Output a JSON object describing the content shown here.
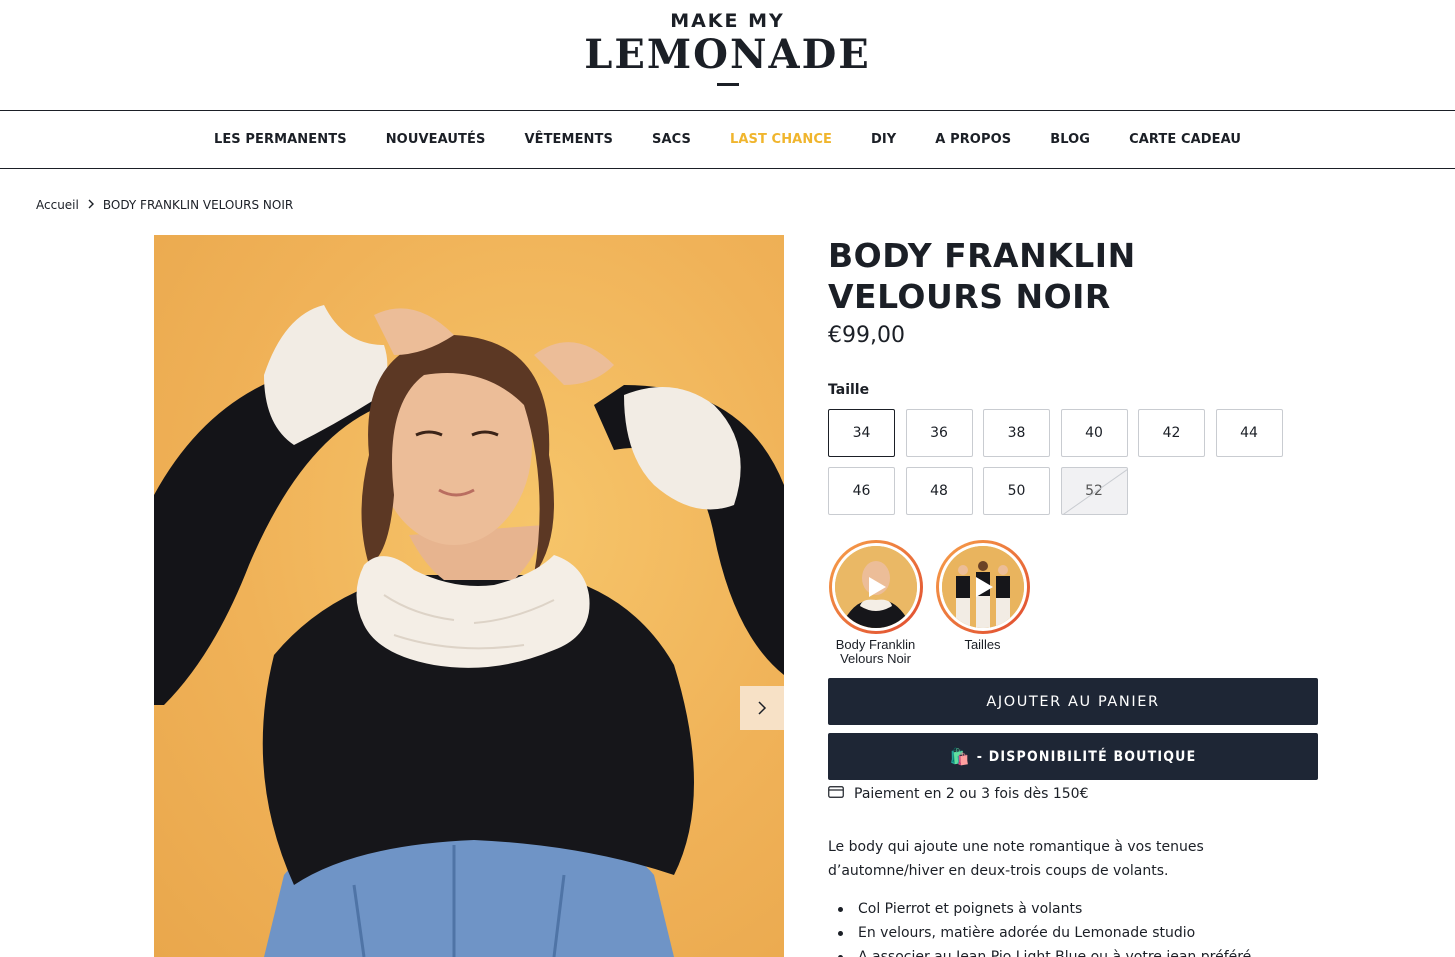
{
  "logo": {
    "top": "MAKE MY",
    "main": "LEMONADE"
  },
  "nav": {
    "items": [
      {
        "label": "LES PERMANENTS"
      },
      {
        "label": "NOUVEAUTÉS"
      },
      {
        "label": "VÊTEMENTS"
      },
      {
        "label": "SACS"
      },
      {
        "label": "LAST CHANCE",
        "highlight": true
      },
      {
        "label": "DIY"
      },
      {
        "label": "A PROPOS"
      },
      {
        "label": "BLOG"
      },
      {
        "label": "CARTE CADEAU"
      }
    ],
    "highlight_color": "#f0b52d"
  },
  "breadcrumb": {
    "home": "Accueil",
    "current": "BODY FRANKLIN VELOURS NOIR"
  },
  "product": {
    "title": "BODY FRANKLIN VELOURS NOIR",
    "price": "€99,00",
    "size_label": "Taille",
    "sizes": [
      {
        "value": "34",
        "state": "selected"
      },
      {
        "value": "36",
        "state": "available"
      },
      {
        "value": "38",
        "state": "available"
      },
      {
        "value": "40",
        "state": "available"
      },
      {
        "value": "42",
        "state": "available"
      },
      {
        "value": "44",
        "state": "available"
      },
      {
        "value": "46",
        "state": "available"
      },
      {
        "value": "48",
        "state": "available"
      },
      {
        "value": "50",
        "state": "available"
      },
      {
        "value": "52",
        "state": "unavailable"
      }
    ],
    "stories": [
      {
        "label": "Body Franklin Velours Noir"
      },
      {
        "label": "Tailles"
      }
    ],
    "add_to_cart": "AJOUTER AU PANIER",
    "store_availability": "- DISPONIBILITÉ BOUTIQUE",
    "store_icon": "🛍️",
    "payment_note": "Paiement en 2 ou 3 fois dès 150€",
    "description": "Le body qui ajoute une note romantique à vos tenues d’automne/hiver en deux-trois coups de volants.",
    "bullets": [
      "Col Pierrot et poignets à volants",
      "En velours, matière adorée du Lemonade studio",
      "A associer au Jean Pio Light Blue ou à votre jean préféré"
    ]
  },
  "colors": {
    "button_bg": "#1e2635",
    "photo_bg": "#f1b45b"
  }
}
